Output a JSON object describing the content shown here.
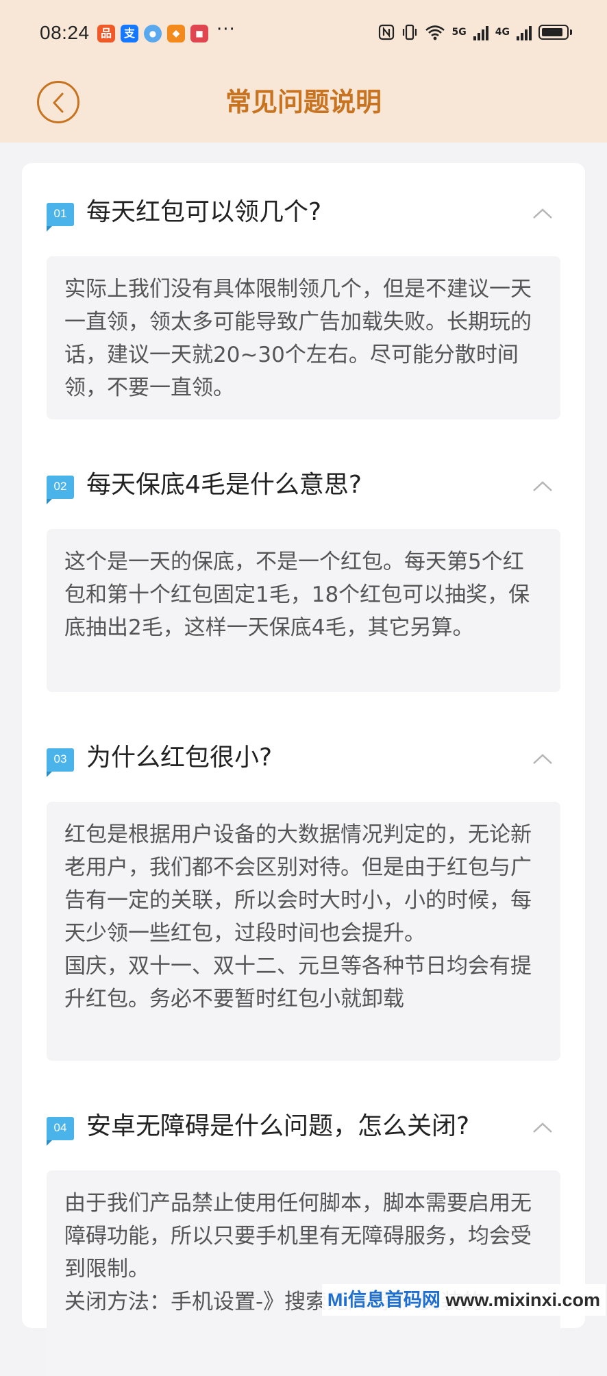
{
  "status_bar": {
    "time": "08:24",
    "app_icons": [
      {
        "name": "app-icon-1",
        "glyph": "品",
        "color": "#f05a28"
      },
      {
        "name": "alipay-icon",
        "glyph": "支",
        "color": "#1677ff"
      },
      {
        "name": "app-icon-3",
        "glyph": "●",
        "color": "#5aa9ef"
      },
      {
        "name": "app-icon-4",
        "glyph": "◆",
        "color": "#f28a1d"
      },
      {
        "name": "app-icon-5",
        "glyph": "■",
        "color": "#e0464f"
      }
    ],
    "more": "···",
    "net_5g": "5G",
    "net_4g": "4G"
  },
  "header": {
    "title": "常见问题说明",
    "back_icon": "chevron-left-icon",
    "accent_color": "#c8731f",
    "background": "#f8e6d6"
  },
  "faqs": [
    {
      "number": "01",
      "question": "每天红包可以领几个?",
      "answer": [
        "实际上我们没有具体限制领几个，但是不建议一天一直领，领太多可能导致广告加载失败。长期玩的话，建议一天就20~30个左右。尽可能分散时间领，不要一直领。"
      ]
    },
    {
      "number": "02",
      "question": "每天保底4毛是什么意思?",
      "answer": [
        "这个是一天的保底，不是一个红包。每天第5个红包和第十个红包固定1毛，18个红包可以抽奖，保底抽出2毛，这样一天保底4毛，其它另算。"
      ]
    },
    {
      "number": "03",
      "question": "为什么红包很小?",
      "answer": [
        "红包是根据用户设备的大数据情况判定的，无论新老用户，我们都不会区别对待。但是由于红包与广告有一定的关联，所以会时大时小，小的时候，每天少领一些红包，过段时间也会提升。",
        "国庆，双十一、双十二、元旦等各种节日均会有提升红包。务必不要暂时红包小就卸载"
      ]
    },
    {
      "number": "04",
      "question": "安卓无障碍是什么问题，怎么关闭?",
      "answer": [
        "由于我们产品禁止使用任何脚本，脚本需要启用无障碍功能，所以只要手机里有无障碍服务，均会受到限制。",
        "关闭方法：手机设置-》搜索无障碍-》安装的"
      ]
    }
  ],
  "watermark": {
    "brand": "Mi信息首码网",
    "url": "www.mixinxi.com"
  }
}
